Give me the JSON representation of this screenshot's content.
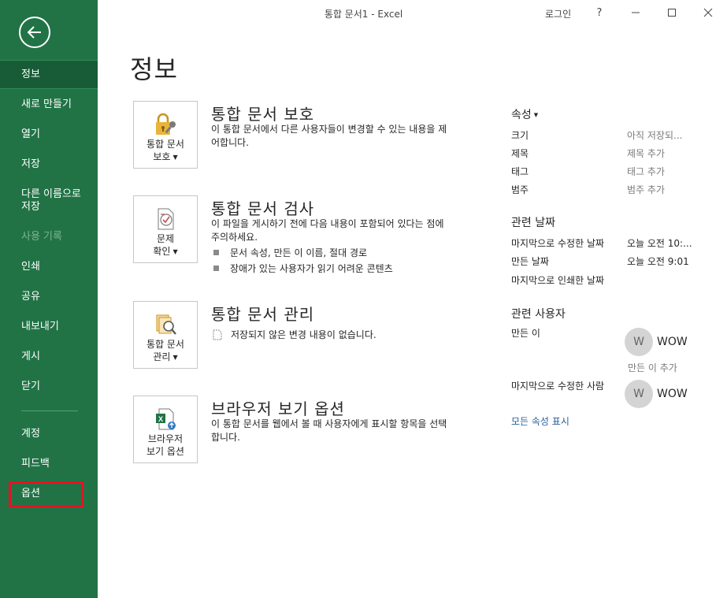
{
  "window": {
    "title": "통합 문서1  -  Excel",
    "login": "로그인",
    "help": "?"
  },
  "sidebar": {
    "items": [
      {
        "label": "정보"
      },
      {
        "label": "새로 만들기"
      },
      {
        "label": "열기"
      },
      {
        "label": "저장"
      },
      {
        "label": "다른 이름으로\n저장"
      },
      {
        "label": "사용 기록"
      },
      {
        "label": "인쇄"
      },
      {
        "label": "공유"
      },
      {
        "label": "내보내기"
      },
      {
        "label": "게시"
      },
      {
        "label": "닫기"
      },
      {
        "label": "계정"
      },
      {
        "label": "피드백"
      },
      {
        "label": "옵션"
      }
    ]
  },
  "main": {
    "title": "정보",
    "protect": {
      "btn_line1": "통합 문서",
      "btn_line2": "보호",
      "title": "통합 문서 보호",
      "desc": "이 통합 문서에서 다른 사용자들이 변경할 수 있는 내용을 제어합니다."
    },
    "inspect": {
      "btn_line1": "문제",
      "btn_line2": "확인",
      "title": "통합 문서 검사",
      "desc": "이 파일을 게시하기 전에 다음 내용이 포함되어 있다는 점에 주의하세요.",
      "bullets": [
        "문서 속성, 만든 이 이름, 절대 경로",
        "장애가 있는 사용자가 읽기 어려운 콘텐츠"
      ]
    },
    "manage": {
      "btn_line1": "통합 문서",
      "btn_line2": "관리",
      "title": "통합 문서 관리",
      "note": "저장되지 않은 변경 내용이 없습니다."
    },
    "browser": {
      "btn_line1": "브라우저",
      "btn_line2": "보기 옵션",
      "title": "브라우저 보기 옵션",
      "desc": "이 통합 문서를 웹에서 볼 때 사용자에게 표시할 항목을 선택합니다."
    }
  },
  "properties": {
    "heading": "속성",
    "rows": [
      {
        "label": "크기",
        "value": "아직 저장되..."
      },
      {
        "label": "제목",
        "value": "제목 추가"
      },
      {
        "label": "태그",
        "value": "태그 추가"
      },
      {
        "label": "범주",
        "value": "범주 추가"
      }
    ],
    "dates_heading": "관련 날짜",
    "dates": [
      {
        "label": "마지막으로 수정한 날짜",
        "value": "오늘 오전 10:..."
      },
      {
        "label": "만든 날짜",
        "value": "오늘 오전 9:01"
      },
      {
        "label": "마지막으로 인쇄한 날짜",
        "value": ""
      }
    ],
    "people_heading": "관련 사용자",
    "author_label": "만든 이",
    "author_initial": "W",
    "author_name": "WOW",
    "add_author": "만든 이 추가",
    "modifier_label": "마지막으로 수정한 사람",
    "modifier_initial": "W",
    "modifier_name": "WOW",
    "show_all": "모든 속성 표시"
  },
  "colors": {
    "sidebar": "#217346",
    "sidebar_selected": "#185c37",
    "highlight": "#e81123",
    "link": "#2a6099"
  }
}
